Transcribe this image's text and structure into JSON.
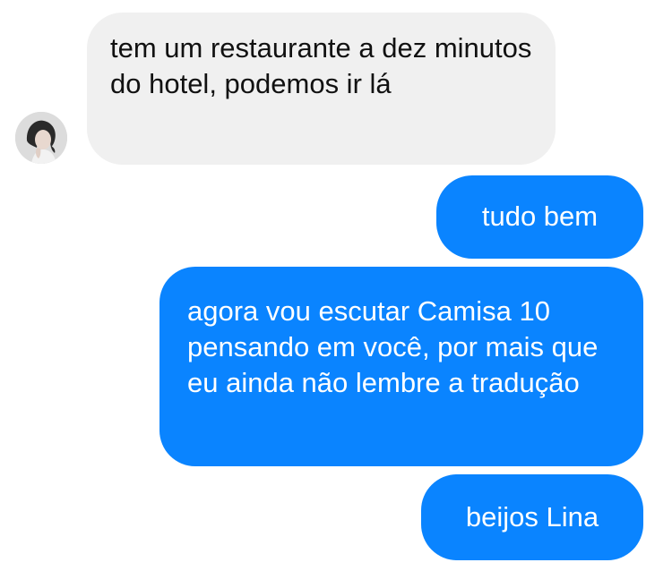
{
  "conversation": {
    "messages": [
      {
        "sender": "contact",
        "text": "tem um restaurante a dez minutos do hotel, podemos ir lá"
      },
      {
        "sender": "me",
        "text": "tudo bem"
      },
      {
        "sender": "me",
        "text": "agora vou escutar Camisa 10 pensando em você, por mais que eu ainda não lembre a tradução"
      },
      {
        "sender": "me",
        "text": "beijos Lina"
      }
    ],
    "contact_avatar": {
      "icon": "contact-avatar-photo"
    },
    "colors": {
      "incoming_bubble": "#f0f0f0",
      "outgoing_bubble": "#0a84ff",
      "incoming_text": "#111111",
      "outgoing_text": "#ffffff"
    }
  }
}
